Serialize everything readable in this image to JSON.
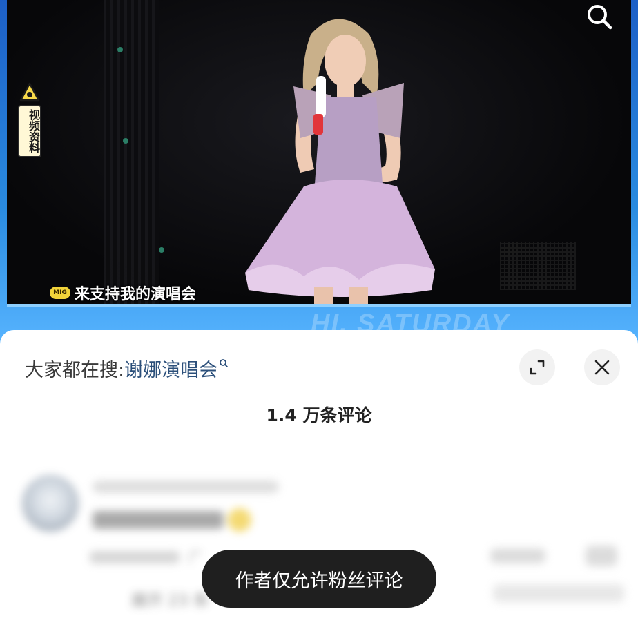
{
  "video": {
    "side_tag": "视频资料",
    "subtitle_badge": "MIG",
    "subtitle": "来支持我的演唱会",
    "watermark": "HI, SATURDAY",
    "search_icon": "search-icon"
  },
  "comment_sheet": {
    "trending_prefix": "大家都在搜:",
    "trending_term": "谢娜演唱会",
    "count_label": "1.4 万条评论",
    "expand_icon": "expand-icon",
    "close_icon": "close-icon",
    "comment": {
      "location": "广",
      "expand_replies": "展开 23 条"
    }
  },
  "toast": {
    "message": "作者仅允许粉丝评论"
  }
}
